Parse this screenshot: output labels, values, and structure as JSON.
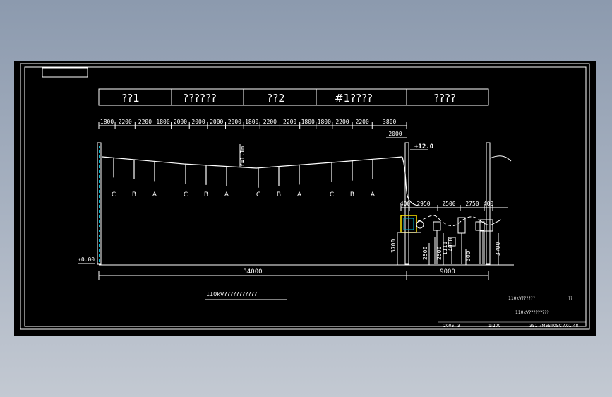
{
  "drawing": {
    "table_headers": [
      "??1",
      "??????",
      "??2",
      "#1????",
      "????"
    ],
    "top_dimensions": [
      "1800",
      "2200",
      "2200",
      "1800",
      "2000",
      "2000",
      "2000",
      "2000",
      "1800",
      "2200",
      "2200",
      "1800",
      "1800",
      "2200",
      "2200",
      "3800"
    ],
    "dim_2000_right": "2000",
    "level_right": "+12.0",
    "level_ground": "±0.00",
    "sag_label": "f=1.1m",
    "phase_labels": [
      "C",
      "B",
      "A",
      "C",
      "B",
      "A",
      "C",
      "B",
      "A",
      "C",
      "B",
      "A"
    ],
    "bay_dimensions": [
      "400",
      "2950",
      "2500",
      "2750",
      "400"
    ],
    "vertical_dims": [
      "3700",
      "2500",
      "2500",
      "1111",
      "4000",
      "300",
      "3700"
    ],
    "bottom_dims": [
      "34000",
      "9000"
    ],
    "section_title": "110kV???????????",
    "note_top_right": "110kV??????",
    "note_mark": "??",
    "note_bottom_right": "110kV?????????",
    "title_block": [
      "2006",
      "3",
      "1:200",
      "351-7M6ST05C-A01-48"
    ]
  }
}
